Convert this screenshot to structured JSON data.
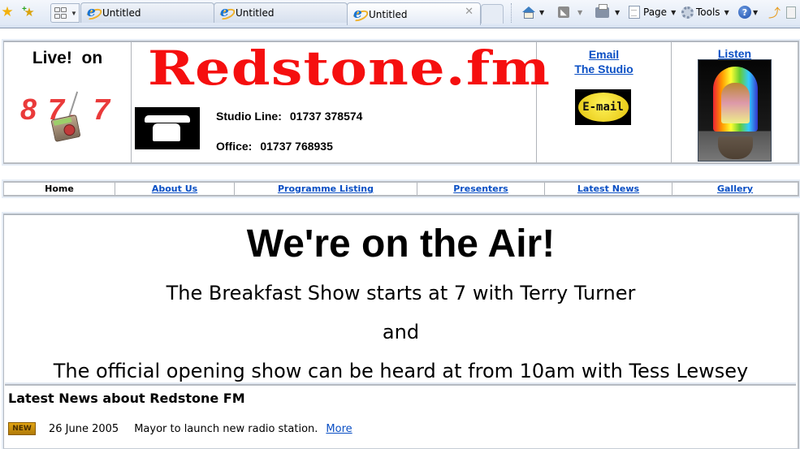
{
  "browser": {
    "tabs": [
      {
        "label": "Untitled",
        "active": false
      },
      {
        "label": "Untitled",
        "active": false
      },
      {
        "label": "Untitled",
        "active": true
      }
    ],
    "commands": {
      "page_label": "Page",
      "tools_label": "Tools"
    },
    "icons": [
      "favorites-star-icon",
      "add-favorite-icon",
      "quick-tabs-icon",
      "home-icon",
      "feeds-icon",
      "print-icon",
      "page-icon",
      "tools-gear-icon",
      "help-icon",
      "research-icon",
      "blog-icon"
    ]
  },
  "header": {
    "live_label": "Live!  on",
    "frequency": [
      "8",
      "7",
      ".",
      "7"
    ],
    "logo_text": "Redstone.fm",
    "studio_line_label": "Studio Line:",
    "studio_line_number": "01737 378574",
    "office_label": "Office:",
    "office_number": "01737 768935",
    "email_link_line1": "Email",
    "email_link_line2": "The Studio",
    "email_button_text": "E-mail",
    "listen_link": "Listen"
  },
  "nav": {
    "items": [
      {
        "label": "Home",
        "current": true
      },
      {
        "label": "About Us",
        "current": false
      },
      {
        "label": "Programme Listing",
        "current": false
      },
      {
        "label": "Presenters",
        "current": false
      },
      {
        "label": "Latest News",
        "current": false
      },
      {
        "label": "Gallery",
        "current": false
      }
    ]
  },
  "main": {
    "headline": "We're on the Air!",
    "line1": "The Breakfast Show starts at 7 with Terry Turner",
    "line2": "and",
    "line3": "The official opening show can be heard at from 10am with Tess Lewsey"
  },
  "news": {
    "title": "Latest News about Redstone FM",
    "items": [
      {
        "badge": "NEW",
        "date": "26 June 2005",
        "text": "Mayor to launch new radio station.",
        "more_label": "More"
      }
    ]
  }
}
